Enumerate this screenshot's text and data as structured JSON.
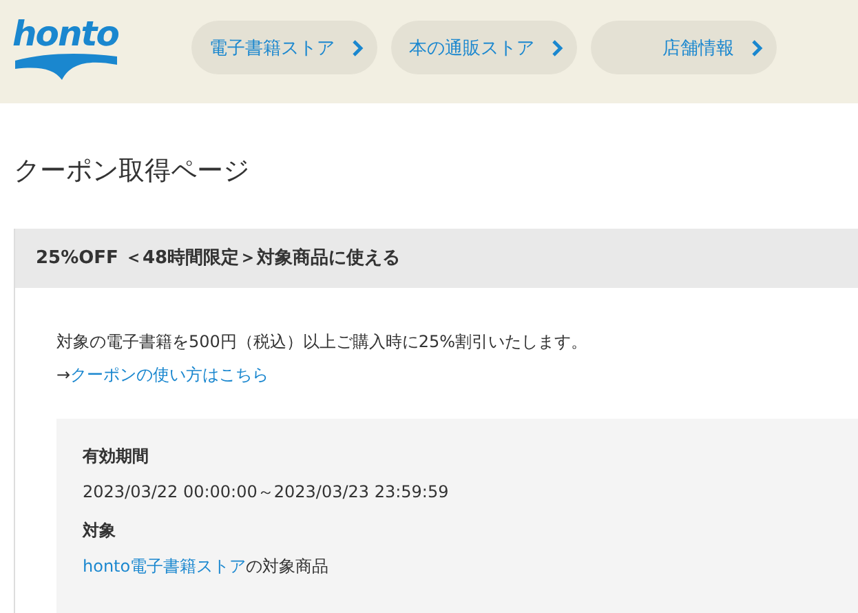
{
  "header": {
    "logo": "honto",
    "nav": [
      {
        "label": "電子書籍ストア"
      },
      {
        "label": "本の通販ストア"
      },
      {
        "label": "店舗情報"
      }
    ]
  },
  "page_title": "クーポン取得ページ",
  "coupon": {
    "title": "25%OFF ＜48時間限定＞対象商品に使える",
    "description": "対象の電子書籍を500円（税込）以上ご購入時に25%割引いたします。",
    "howto": {
      "prefix": "→",
      "link": "クーポンの使い方はこちら"
    },
    "details": [
      {
        "label": "有効期間",
        "value": "2023/03/22 00:00:00～2023/03/23 23:59:59"
      },
      {
        "label": "対象",
        "link": "honto電子書籍ストア",
        "value": "の対象商品"
      }
    ]
  }
}
